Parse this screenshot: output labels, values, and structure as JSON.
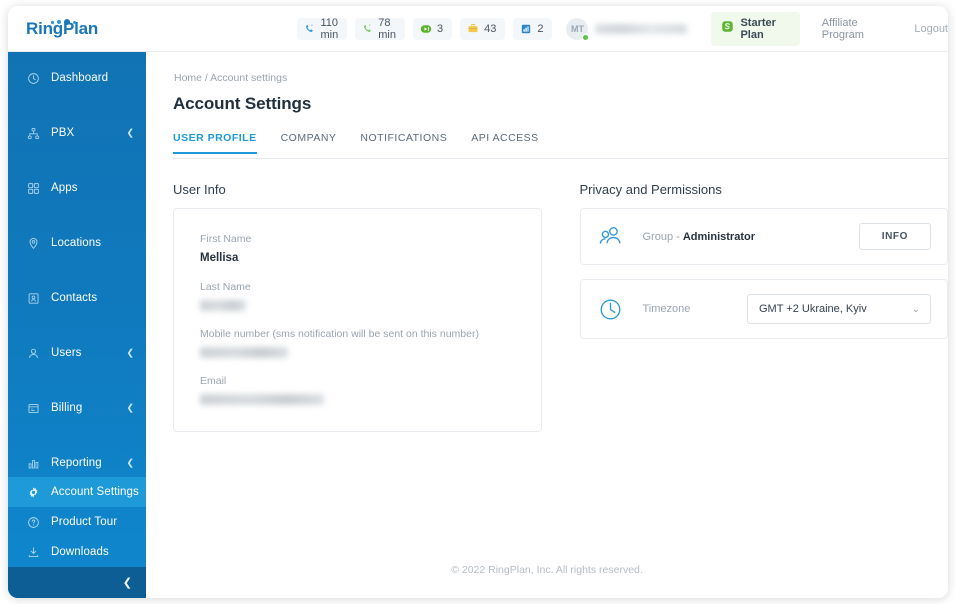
{
  "brand": {
    "name": "RingPlan",
    "logo_icon": "ringplan-dots-logo",
    "accent": "#1e9ad9",
    "sidebar_blue": "#1173b4"
  },
  "topbar": {
    "stats": [
      {
        "icon": "phone-incoming-icon",
        "value": "110 min",
        "color": "#2e9bd6"
      },
      {
        "icon": "phone-outgoing-icon",
        "value": "78 min",
        "color": "#6ec15c"
      },
      {
        "icon": "voicemail-play-icon",
        "value": "3",
        "color": "#5cb531"
      },
      {
        "icon": "briefcase-icon",
        "value": "43",
        "color": "#f0c244"
      },
      {
        "icon": "fax-report-icon",
        "value": "2",
        "color": "#2e86c8"
      }
    ],
    "user": {
      "initials": "MT",
      "name_redacted": true,
      "status": "online",
      "status_color": "#5cc24a"
    },
    "plan": {
      "icon": "plan-s-icon",
      "label": "Starter Plan",
      "color": "#5cb531"
    },
    "links": [
      {
        "label": "Affiliate Program"
      },
      {
        "label": "Logout"
      }
    ]
  },
  "sidebar": {
    "items": [
      {
        "label": "Dashboard",
        "icon": "dashboard-clock-icon",
        "expandable": false,
        "active": false
      },
      {
        "label": "PBX",
        "icon": "pbx-network-icon",
        "expandable": true,
        "active": false
      },
      {
        "label": "Apps",
        "icon": "apps-grid-icon",
        "expandable": false,
        "active": false
      },
      {
        "label": "Locations",
        "icon": "location-pin-icon",
        "expandable": false,
        "active": false
      },
      {
        "label": "Contacts",
        "icon": "contacts-book-icon",
        "expandable": false,
        "active": false
      },
      {
        "label": "Users",
        "icon": "user-icon",
        "expandable": true,
        "active": false
      },
      {
        "label": "Billing",
        "icon": "billing-card-icon",
        "expandable": true,
        "active": false
      },
      {
        "label": "Reporting",
        "icon": "reporting-bars-icon",
        "expandable": true,
        "active": false
      }
    ],
    "bottom_items": [
      {
        "label": "Account Settings",
        "icon": "gear-icon",
        "active": true
      },
      {
        "label": "Product Tour",
        "icon": "question-circle-icon",
        "active": false
      },
      {
        "label": "Downloads",
        "icon": "download-icon",
        "active": false
      }
    ],
    "collapse_icon": "chevron-left-icon"
  },
  "main": {
    "breadcrumb": "Home / Account settings",
    "title": "Account Settings",
    "tabs": [
      {
        "label": "USER PROFILE",
        "active": true
      },
      {
        "label": "COMPANY",
        "active": false
      },
      {
        "label": "NOTIFICATIONS",
        "active": false
      },
      {
        "label": "API ACCESS",
        "active": false
      }
    ],
    "user_info": {
      "section_title": "User Info",
      "fields": [
        {
          "label": "First Name",
          "value": "Mellisa",
          "redacted": false
        },
        {
          "label": "Last Name",
          "value": "",
          "redacted": true
        },
        {
          "label": "Mobile number (sms notification will be sent on this number)",
          "value": "",
          "redacted": true
        },
        {
          "label": "Email",
          "value": "",
          "redacted": true
        }
      ]
    },
    "privacy": {
      "section_title": "Privacy and Permissions",
      "group_row": {
        "icon": "users-group-icon",
        "label_prefix": "Group - ",
        "label_value": "Administrator",
        "button": "INFO"
      },
      "timezone_row": {
        "icon": "clock-icon",
        "label": "Timezone",
        "selected": "GMT +2 Ukraine, Kyiv",
        "chevron": "chevron-down-icon"
      }
    },
    "footer": "© 2022 RingPlan, Inc. All rights reserved."
  }
}
